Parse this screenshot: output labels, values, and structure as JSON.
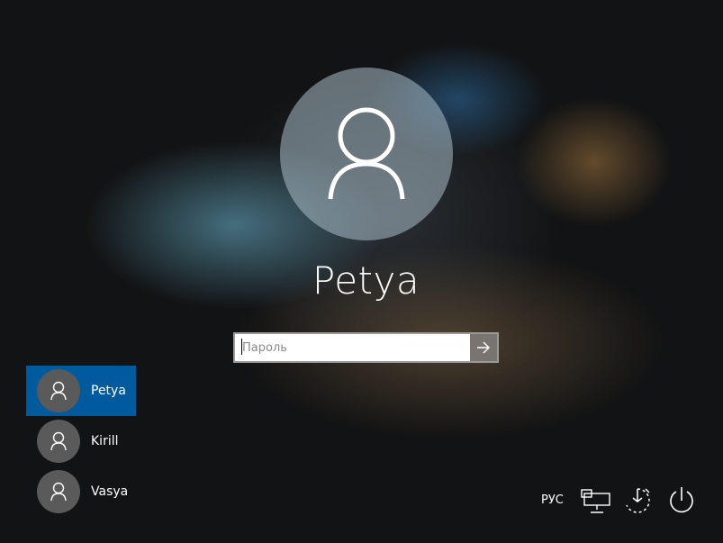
{
  "login": {
    "current_user": "Petya",
    "password_placeholder": "Пароль"
  },
  "users": [
    {
      "name": "Petya",
      "selected": true
    },
    {
      "name": "Kirill",
      "selected": false
    },
    {
      "name": "Vasya",
      "selected": false
    }
  ],
  "tray": {
    "language": "РУС",
    "icons": [
      "network-icon",
      "accessibility-icon",
      "power-icon"
    ]
  },
  "colors": {
    "selection": "#005a9e",
    "text": "#ffffff",
    "avatar_small": "#5a5a5a"
  }
}
